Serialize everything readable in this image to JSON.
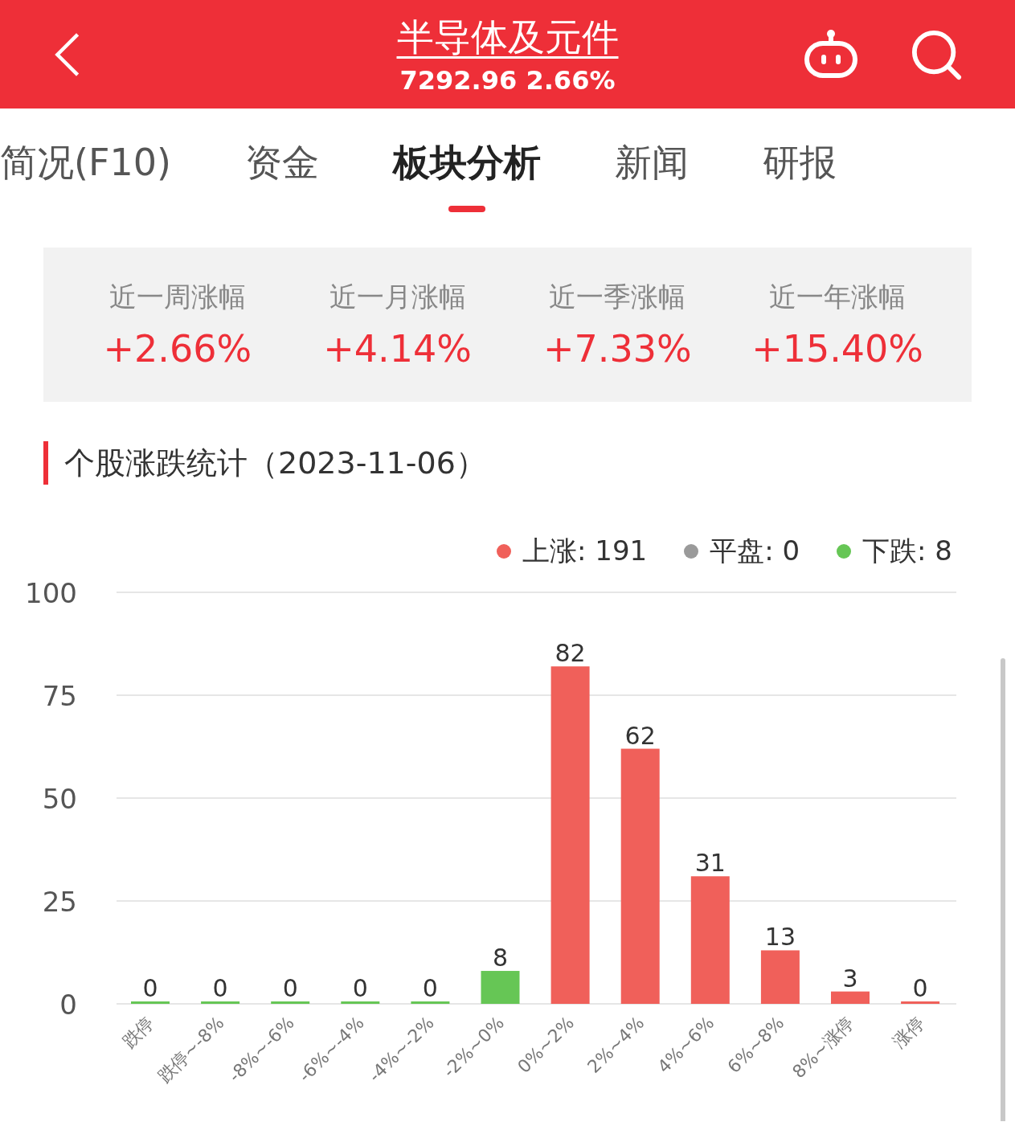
{
  "header": {
    "title": "半导体及元件",
    "quote": "7292.96 2.66%"
  },
  "tabs": [
    {
      "label": "简况(F10)",
      "selected": false
    },
    {
      "label": "资金",
      "selected": false
    },
    {
      "label": "板块分析",
      "selected": true
    },
    {
      "label": "新闻",
      "selected": false
    },
    {
      "label": "研报",
      "selected": false
    }
  ],
  "performance": [
    {
      "label": "近一周涨幅",
      "value": "+2.66%"
    },
    {
      "label": "近一月涨幅",
      "value": "+4.14%"
    },
    {
      "label": "近一季涨幅",
      "value": "+7.33%"
    },
    {
      "label": "近一年涨幅",
      "value": "+15.40%"
    }
  ],
  "section_title": "个股涨跌统计（2023-11-06）",
  "legend": [
    {
      "label": "上涨: 191",
      "color": "#f0605a"
    },
    {
      "label": "平盘: 0",
      "color": "#9a9a9a"
    },
    {
      "label": "下跌: 8",
      "color": "#66c655"
    }
  ],
  "chart_data": {
    "type": "bar",
    "categories": [
      "跌停",
      "跌停~-8%",
      "-8%~-6%",
      "-6%~-4%",
      "-4%~-2%",
      "-2%~0%",
      "0%~2%",
      "2%~4%",
      "4%~6%",
      "6%~8%",
      "8%~涨停",
      "涨停"
    ],
    "values": [
      0,
      0,
      0,
      0,
      0,
      8,
      82,
      62,
      31,
      13,
      3,
      0
    ],
    "colors": [
      "#66c655",
      "#66c655",
      "#66c655",
      "#66c655",
      "#66c655",
      "#66c655",
      "#f0605a",
      "#f0605a",
      "#f0605a",
      "#f0605a",
      "#f0605a",
      "#f0605a"
    ],
    "ylim": [
      0,
      100
    ],
    "yticks": [
      0,
      25,
      50,
      75,
      100
    ],
    "grid": true,
    "data_labels": true
  }
}
